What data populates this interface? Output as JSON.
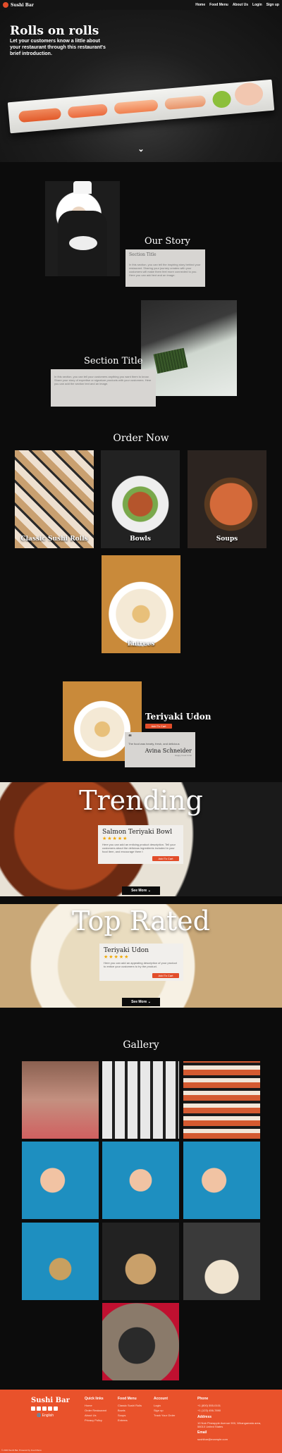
{
  "nav": {
    "brand": "Sushi Bar",
    "links": [
      "Home",
      "Food Menu",
      "About Us",
      "Login",
      "Sign up"
    ]
  },
  "hero": {
    "title": "Rolls on rolls",
    "subtitle": "Let your customers know a little about your restaurant through this restaurant's brief introduction."
  },
  "story": {
    "title": "Our Story",
    "card_title": "Section Title",
    "card_body": "In this section, you can tell the inspiring story behind your restaurant. Sharing your journey creates with your customers will make them feel more connected to you. Here you can add text and an image."
  },
  "section2": {
    "title": "Section Title",
    "card_body": "In this section, you can tell your customers anything you want them to know. Share your story of expertise or signature products with your customers. Here you can add the section text and an image."
  },
  "order": {
    "title": "Order Now",
    "categories": [
      "Classic Sushi Rolls",
      "Bowls",
      "Soups",
      "Entrees"
    ]
  },
  "feature": {
    "title": "Teriyaki Udon",
    "button": "Add To Cart",
    "quote": "The food was hearty, fresh, and delicious",
    "author": "Avina Schneider",
    "author_role": "Happy Food Critic"
  },
  "trending": {
    "heading": "Trending",
    "item_title": "Salmon Teriyaki Bowl",
    "stars": "★★★★★",
    "desc": "Here you can add an enticing product description. Tell your customers about the delicious ingredients included in your food item, and encourage them t",
    "button": "Add To Cart",
    "see_more": "See More ⌄"
  },
  "top_rated": {
    "heading": "Top Rated",
    "item_title": "Teriyaki Udon",
    "stars": "★★★★★",
    "desc": "Here you can add an appealing description of your product to entice your customers to try the product.",
    "button": "Add To Cart",
    "see_more": "See More ⌄"
  },
  "gallery": {
    "title": "Gallery"
  },
  "footer": {
    "brand": "Sushi Bar",
    "language": "English",
    "quick_links_title": "Quick links",
    "quick_links": [
      "Home",
      "Order Restaurant",
      "About Us",
      "Privacy Policy"
    ],
    "food_menu_title": "Food Menu",
    "food_menu": [
      "Classic Sushi Rolls",
      "Bowls",
      "Soups",
      "Entrees"
    ],
    "account_title": "Account",
    "account": [
      "Login",
      "Sign up",
      "Track Your Order"
    ],
    "phone_title": "Phone",
    "phones": [
      "+1 (800) 555-0101",
      "+1 (123) 456-7890"
    ],
    "address_title": "Address",
    "address": "10 Nob Pineapple Avenue 900, Whangamata area, 58010 United States",
    "email_title": "Email",
    "email": "sushibar@example.com",
    "copyright": "© 2023 Sushi Bar. Powered by Food Menu"
  },
  "colors": {
    "accent": "#e9522b",
    "background": "#0c0c0c",
    "star": "#f0a800"
  }
}
